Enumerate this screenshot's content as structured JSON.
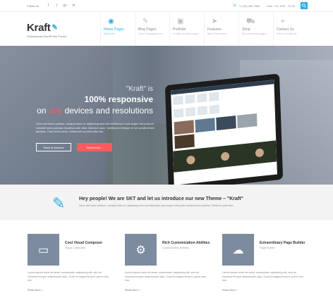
{
  "topbar": {
    "follow_label": "Follow us",
    "social": [
      "f",
      "t",
      "g+",
      "in"
    ],
    "phone": "+1 (23) 456 7890",
    "hours": "Mon - Fri: 9:00 - 21:00"
  },
  "header": {
    "logo": "Kraft",
    "tagline": "Professional WordPress Theme",
    "nav": [
      {
        "label": "Home Pages",
        "sub": "Basic Info"
      },
      {
        "label": "Blog Pages",
        "sub": "Some blogpages here"
      },
      {
        "label": "Portfolio",
        "sub": "Creative portfolio pages"
      },
      {
        "label": "Features",
        "sub": "Best Theme Here"
      },
      {
        "label": "Shop",
        "sub": "Woocommerce pages"
      },
      {
        "label": "Contact Us",
        "sub": "Here to contact us"
      }
    ]
  },
  "hero": {
    "line1": "\"Kraft\" is",
    "line2": "100% responsive",
    "line3_pre": "on",
    "line3_em": "any",
    "line3_post": "devices and resolutions",
    "para": "Nunc sed lorem pretium, volutpat tortor et, adipiscing sem sed tellsbeosum quis augue sed porta Ut molestie tortor pulvinar, faucibus ante vitae, interdum nunc. Vestibulum tristique mi vel condimentum faucibus. Proin tortor tortor, vestibulum ut porta vitae nisi.",
    "btn1": "Read in features",
    "btn2": "Read more..."
  },
  "intro": {
    "title": "Hey people! We are SKT and let us introduce our new Theme – \"Kraft\"",
    "para": "Nunc sed lorem pretium, volutpat tortor et, adipiscing sem sed bibendum quis augue sed porta condimentum pulvinar, Eleifend, pulla ante."
  },
  "features": [
    {
      "title": "Cool Visual Composer",
      "sub": "Visual Composer",
      "body": "Lorem ipsum dolor sit amet, consectetur adipiscing elit, sed do eiusmod tempor ullamcorper odio. Cras id magna tempor, porta eros nisi.",
      "more": "Read More >"
    },
    {
      "title": "Rich Customization Abilities",
      "sub": "Customization Abilities",
      "body": "Lorem ipsum dolor sit amet, consectetur adipiscing elit, sed do eiusmod tempor ullamcorper odio. Cras id magna tempor, porta eros nisi.",
      "more": "Read More >"
    },
    {
      "title": "Extraordinary Page Builder",
      "sub": "Page Builder",
      "body": "Lorem ipsum dolor sit amet, consectetur adipiscing elit, sed do eiusmod tempor ullamcorper odio. Cras id magna tempor, porta eros nisi.",
      "more": "Read More >"
    }
  ],
  "colors": {
    "accent": "#29aee3",
    "highlight": "#ff5a5f",
    "feature_box": "#7d8b9e"
  },
  "icons": {
    "nav": [
      "globe-icon",
      "pencil-icon",
      "camera-icon",
      "paper-plane-icon",
      "cart-icon",
      "map-pin-icon"
    ],
    "features": [
      "monitor-icon",
      "gears-icon",
      "cloud-download-icon"
    ]
  }
}
